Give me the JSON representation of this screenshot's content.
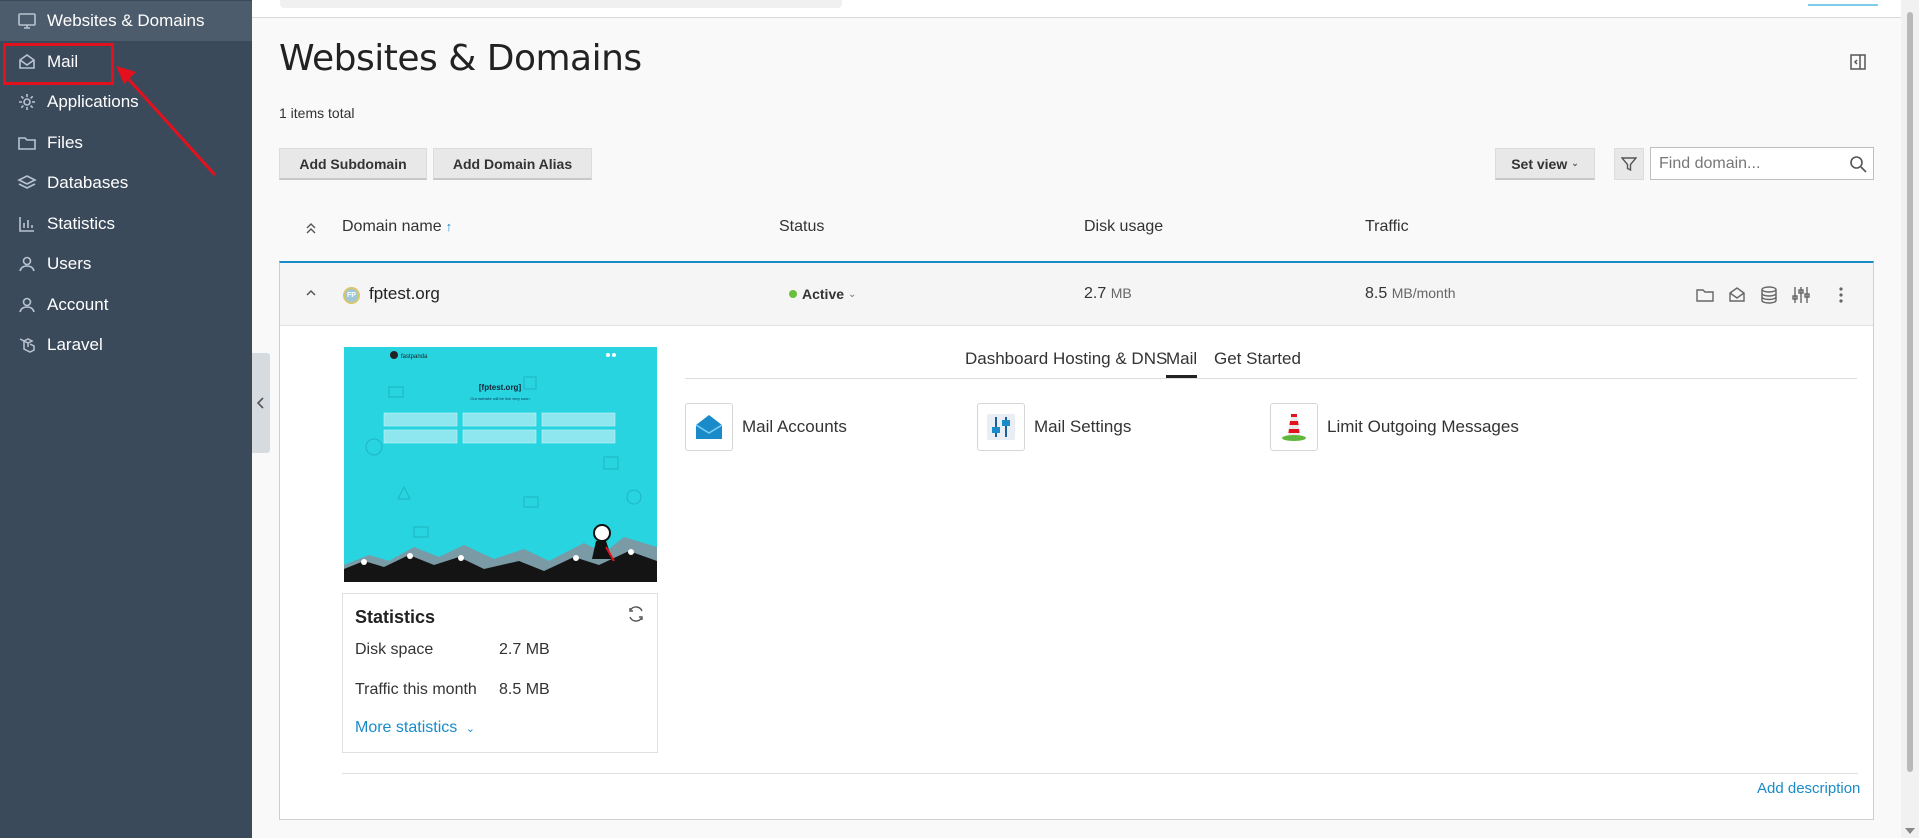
{
  "sidebar": {
    "items": [
      {
        "label": "Websites & Domains",
        "icon": "monitor-icon"
      },
      {
        "label": "Mail",
        "icon": "mail-icon"
      },
      {
        "label": "Applications",
        "icon": "gear-icon"
      },
      {
        "label": "Files",
        "icon": "folder-icon"
      },
      {
        "label": "Databases",
        "icon": "database-icon"
      },
      {
        "label": "Statistics",
        "icon": "bar-chart-icon"
      },
      {
        "label": "Users",
        "icon": "user-icon"
      },
      {
        "label": "Account",
        "icon": "account-icon"
      },
      {
        "label": "Laravel",
        "icon": "laravel-icon"
      }
    ],
    "active_index": 0,
    "highlighted_item": "Mail"
  },
  "page": {
    "title": "Websites & Domains",
    "items_total": "1 items total"
  },
  "toolbar": {
    "add_subdomain": "Add Subdomain",
    "add_domain_alias": "Add Domain Alias",
    "set_view": "Set view",
    "search_placeholder": "Find domain..."
  },
  "table": {
    "columns": {
      "domain": "Domain name",
      "status": "Status",
      "disk": "Disk usage",
      "traffic": "Traffic"
    },
    "sort_indicator": "↑"
  },
  "domain": {
    "name": "fptest.org",
    "favicon_text": "FP",
    "status": "Active",
    "disk_value": "2.7",
    "disk_unit": "MB",
    "traffic_value": "8.5",
    "traffic_unit": "MB/month"
  },
  "preview": {
    "brand": "fastpanda",
    "title": "[fptest.org]",
    "subtitle": "Our website will be live very soon"
  },
  "stats": {
    "title": "Statistics",
    "disk_label": "Disk space",
    "disk_value": "2.7 MB",
    "traffic_label": "Traffic this month",
    "traffic_value": "8.5 MB",
    "more": "More statistics"
  },
  "tabs": [
    "Dashboard",
    "Hosting & DNS",
    "Mail",
    "Get Started"
  ],
  "active_tab": "Mail",
  "mail_tools": [
    {
      "label": "Mail Accounts",
      "icon": "mail-accounts-icon"
    },
    {
      "label": "Mail Settings",
      "icon": "mail-settings-icon"
    },
    {
      "label": "Limit Outgoing Messages",
      "icon": "lighthouse-icon"
    }
  ],
  "footer": {
    "add_description": "Add description"
  },
  "colors": {
    "sidebar_bg": "#3b4a5b",
    "accent": "#1a8bc9",
    "status_active": "#6bbf3b",
    "highlight": "#e3101d",
    "preview_bg": "#27d4e0"
  }
}
